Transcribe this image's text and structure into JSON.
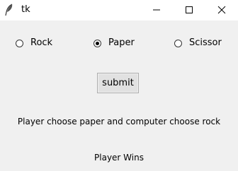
{
  "window": {
    "title": "tk",
    "icon": "feather-icon",
    "controls": [
      "minimize-icon",
      "maximize-icon",
      "close-icon"
    ]
  },
  "options": {
    "rock": {
      "label": "Rock",
      "selected": false
    },
    "paper": {
      "label": "Paper",
      "selected": true
    },
    "scissor": {
      "label": "Scissor",
      "selected": false
    }
  },
  "submit_label": "submit",
  "result": {
    "choice_text": "Player choose paper and computer choose rock",
    "winner_text": "Player Wins"
  }
}
